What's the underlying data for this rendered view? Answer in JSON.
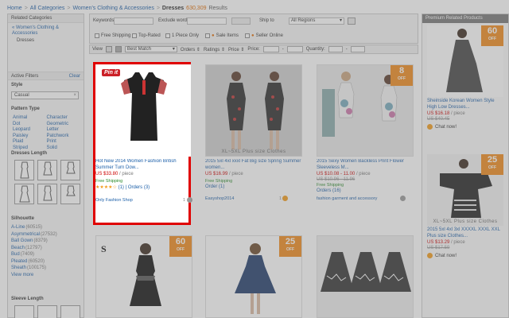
{
  "breadcrumb": {
    "home": "Home",
    "sep": ">",
    "all_categories": "All Categories",
    "womens": "Women's Clothing & Accessories",
    "current": "Dresses",
    "count": "630,309",
    "results": "Results"
  },
  "sidebar": {
    "related_header": "Related Categories",
    "related_link": "« Women's Clothing & Accessories",
    "related_sub": "Dresses",
    "active_filters": "Active Filters",
    "clear": "Clear",
    "style_heading": "Style",
    "style_chip": "Casual",
    "chip_close": "×",
    "pattern_heading": "Pattern Type",
    "patterns": [
      "Animal",
      "Character",
      "Dot",
      "Geometric",
      "Leopard",
      "Letter",
      "Paisley",
      "Patchwork",
      "Plaid",
      "Print",
      "Striped",
      "Solid"
    ],
    "dress_length_heading": "Dresses Length",
    "silhouette_heading": "Silhouette",
    "silhouettes": [
      {
        "name": "A-Line",
        "count": "(60515)"
      },
      {
        "name": "Asymmetrical",
        "count": "(27532)"
      },
      {
        "name": "Ball Gown",
        "count": "(8379)"
      },
      {
        "name": "Beach",
        "count": "(12797)"
      },
      {
        "name": "Bud",
        "count": "(7409)"
      },
      {
        "name": "Pleated",
        "count": "(60520)"
      },
      {
        "name": "Sheath",
        "count": "(100175)"
      }
    ],
    "view_more": "View more",
    "sleeve_length_heading": "Sleeve Length"
  },
  "filters": {
    "keywords_label": "Keywords",
    "exclude_label": "Exclude words",
    "ship_label": "Ship to",
    "ship_value": "All Regions",
    "free_shipping": "Free Shipping",
    "top_rated": "Top-Rated",
    "one_piece": "1 Piece Only",
    "sale_items": "Sale Items",
    "seller_online": "Seller Online"
  },
  "sortbar": {
    "view_label": "View",
    "sort_value": "Best Match",
    "orders": "Orders",
    "ratings": "Ratings",
    "price": "Price",
    "price_label": "Price:",
    "quantity_label": "Quantity:"
  },
  "products": [
    {
      "title": "Hot New 2014 Women Fashion British Summer Turn Dow...",
      "price": "US $33.80",
      "unit": "/ piece",
      "shipping": "Free Shipping",
      "stars": "★★★★☆",
      "rating": "(1)",
      "orders": "Orders (3)",
      "shop": "Only Fashion Shop",
      "shop_count": "1",
      "badge": "Pin it",
      "discount": "",
      "off": ""
    },
    {
      "title": "2015 5xl 4xl xxxl Fat Big size Spring Summer women...",
      "price": "US $16.99",
      "unit": "/ piece",
      "shipping": "Free Shipping",
      "stars": "",
      "rating": "",
      "orders": "Order (1)",
      "shop": "Easyshop2014",
      "shop_count": "1",
      "badge": "",
      "discount": "",
      "off": "",
      "watermark": "XL~5XL Plus size Clothes"
    },
    {
      "title": "2015 Sexy Women Backless Print Flower Sleeveless M...",
      "price": "US $10.08 - 11.00",
      "old_price": "US $10.96 - 11.96",
      "unit": "/ piece",
      "shipping": "Free Shipping",
      "stars": "",
      "rating": "",
      "orders": "Orders (16)",
      "shop": "fashion garment and accessory",
      "shop_count": "",
      "badge": "",
      "discount": "8",
      "off": "OFF"
    },
    {
      "discount": "60",
      "off": "OFF"
    },
    {
      "discount": "25",
      "off": "OFF"
    },
    {
      "discount": "",
      "off": ""
    }
  ],
  "promo": {
    "header": "Premium Related Products",
    "items": [
      {
        "title": "Sheinside Korean Women Style High Low Dresses...",
        "price": "US $16.18",
        "unit": "/ piece",
        "old_price": "US $40.45",
        "chat": "Chat now!",
        "discount": "60",
        "off": "OFF"
      },
      {
        "title": "2015 5xl 4xl 3xl XXXXL XXXL XXL Plus size Clothes...",
        "price": "US $13.29",
        "unit": "/ piece",
        "old_price": "US $17.59",
        "chat": "Chat now!",
        "discount": "25",
        "off": "OFF",
        "watermark": "XL~5XL Plus size Clothes"
      }
    ]
  },
  "colors": {
    "accent": "#1a5ea8",
    "price": "#cc0000",
    "discount": "#f08a1a",
    "highlight": "#e00000"
  }
}
